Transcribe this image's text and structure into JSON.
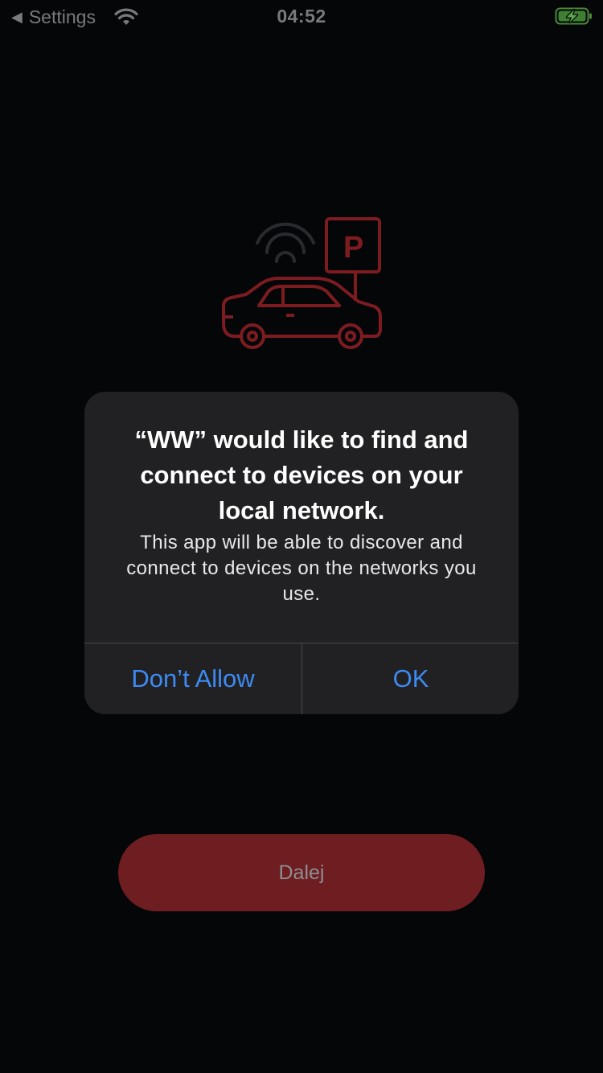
{
  "status_bar": {
    "back_label": "Settings",
    "time": "04:52",
    "icons": [
      "back-arrow-icon",
      "wifi-icon",
      "battery-charging-icon"
    ]
  },
  "illustration": {
    "icon": "car-parking-wifi-icon",
    "sign_letter": "P",
    "color": "#b0262b"
  },
  "alert": {
    "title": "“WW” would like to find and connect to devices on your local network.",
    "message": "This app will be able to discover and connect to devices on the networks you use.",
    "deny_label": "Don’t Allow",
    "ok_label": "OK",
    "button_color": "#3d8bf2"
  },
  "main": {
    "next_button_label": "Dalej",
    "button_color": "#6e1d20"
  }
}
